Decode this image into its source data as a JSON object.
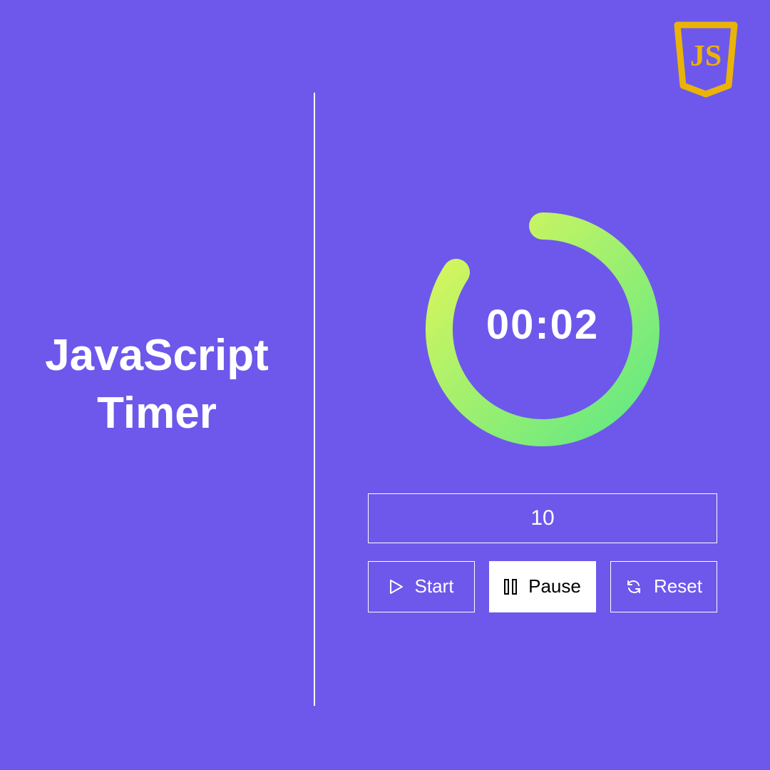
{
  "badge": {
    "text": "JS"
  },
  "title": {
    "line1": "JavaScript",
    "line2": "Timer"
  },
  "timer": {
    "display": "00:02",
    "duration": "10",
    "progress_angle_start": -90,
    "progress_angle_sweep": 290
  },
  "buttons": {
    "start": "Start",
    "pause": "Pause",
    "reset": "Reset",
    "active": "pause"
  },
  "colors": {
    "background": "#6D58EB",
    "accent": "#EAB308",
    "ring_gradient_start": "#E0F75A",
    "ring_gradient_end": "#5EE884"
  }
}
